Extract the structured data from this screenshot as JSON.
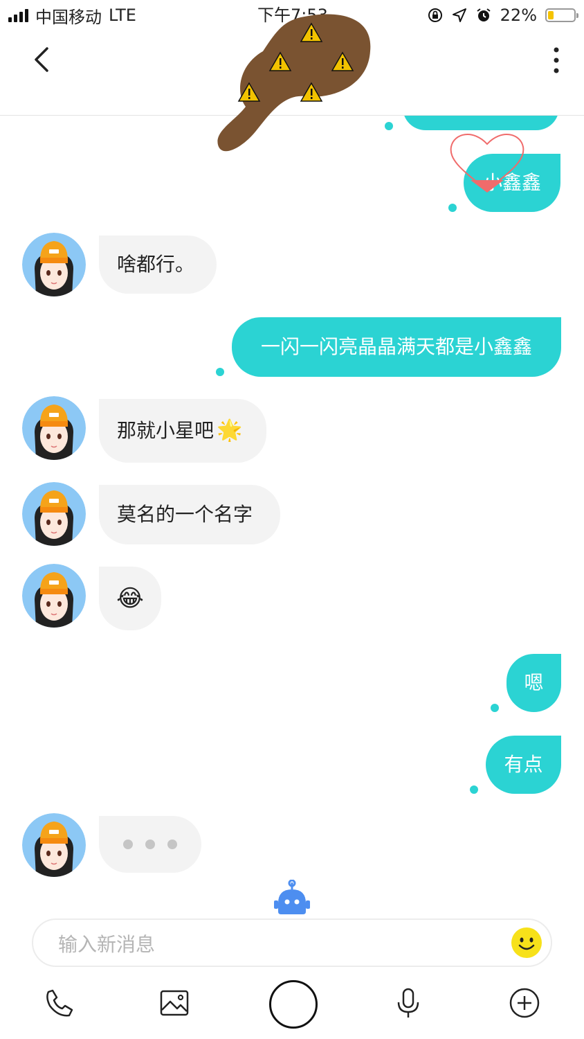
{
  "status_bar": {
    "carrier": "中国移动",
    "network": "LTE",
    "time": "下午7:53",
    "battery_percent": "22%",
    "battery_level": 0.22,
    "icons": [
      "signal-icon",
      "orientation-lock-icon",
      "location-arrow-icon",
      "alarm-icon",
      "battery-icon"
    ]
  },
  "nav": {
    "back_icon": "chevron-left-icon",
    "more_icon": "more-vertical-icon"
  },
  "messages": [
    {
      "side": "out",
      "text": ""
    },
    {
      "side": "out",
      "text": "小鑫鑫"
    },
    {
      "side": "in",
      "text": "啥都行。"
    },
    {
      "side": "out",
      "text": "一闪一闪亮晶晶满天都是小鑫鑫"
    },
    {
      "side": "in",
      "text": "那就小星吧",
      "emoji": "🌟"
    },
    {
      "side": "in",
      "text": "莫名的一个名字"
    },
    {
      "side": "in",
      "emoji": "😂"
    },
    {
      "side": "out",
      "text": "嗯"
    },
    {
      "side": "out",
      "text": "有点"
    },
    {
      "side": "in",
      "typing": true
    }
  ],
  "composer": {
    "placeholder": "输入新消息",
    "emoji_icon": "smiley-icon",
    "assistant_icon": "robot-icon"
  },
  "toolbar": {
    "items": [
      "phone-icon",
      "image-icon",
      "camera-shutter-button",
      "microphone-icon",
      "plus-circle-icon"
    ]
  },
  "colors": {
    "outgoing_bubble": "#2bd3d3",
    "incoming_bubble": "#f3f3f3",
    "robot": "#4d8ef0",
    "emoji_button": "#f7e11a"
  }
}
